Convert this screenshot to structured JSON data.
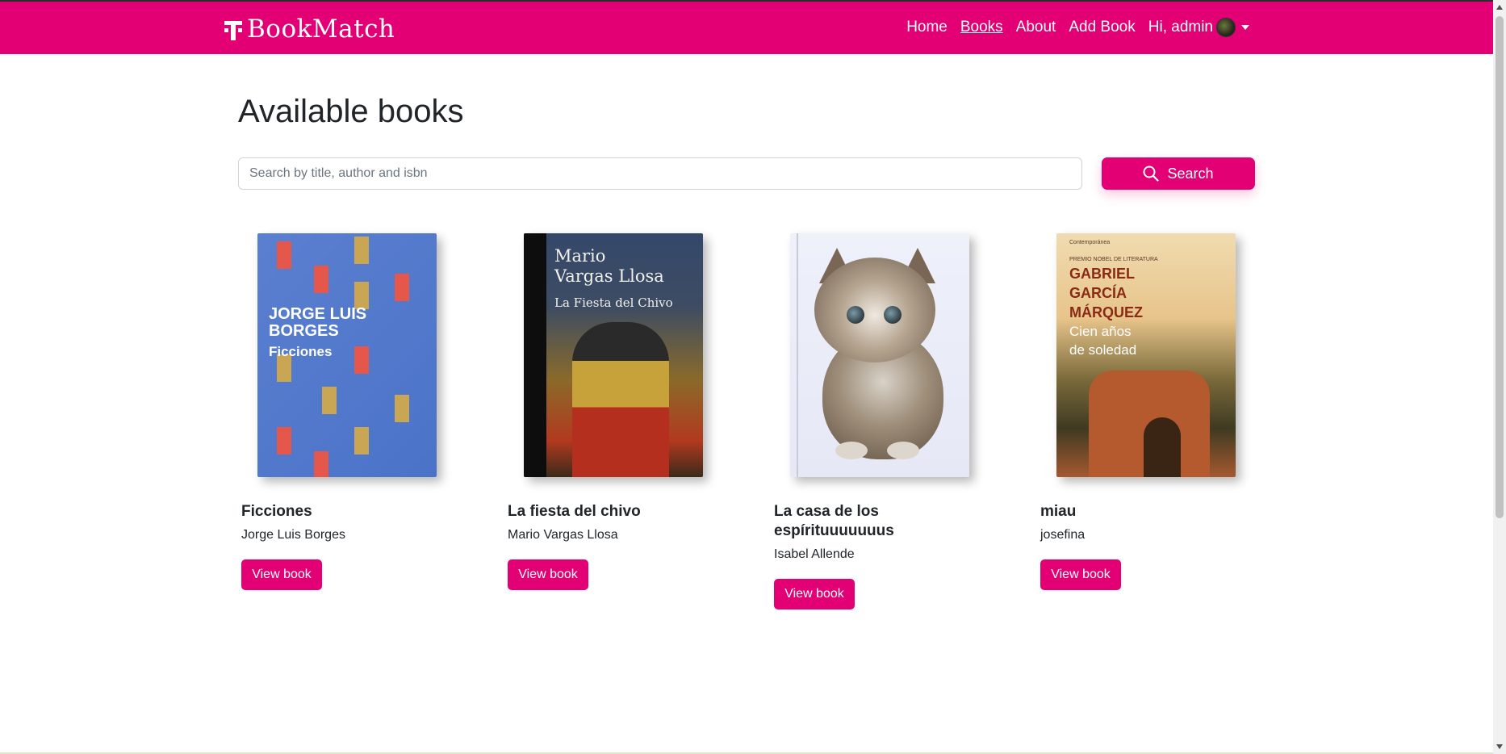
{
  "brand": {
    "name": "BookMatch",
    "icon": "telekom-t-logo"
  },
  "nav": {
    "items": [
      {
        "label": "Home",
        "active": false
      },
      {
        "label": "Books",
        "active": true
      },
      {
        "label": "About",
        "active": false
      },
      {
        "label": "Add Book",
        "active": false
      }
    ],
    "user": {
      "greeting": "Hi, admin"
    }
  },
  "page": {
    "title": "Available books"
  },
  "search": {
    "placeholder": "Search by title, author and isbn",
    "value": "",
    "button_label": "Search",
    "button_icon": "search-icon"
  },
  "books": [
    {
      "title": "Ficciones",
      "author": "Jorge Luis Borges",
      "button_label": "View book",
      "cover": {
        "line1": "JORGE LUIS",
        "line2": "BORGES",
        "line3": "Ficciones"
      }
    },
    {
      "title": "La fiesta del chivo",
      "author": "Mario Vargas Llosa",
      "button_label": "View book",
      "cover": {
        "line1": "Mario",
        "line2": "Vargas Llosa",
        "line3": "La Fiesta del Chivo"
      }
    },
    {
      "title": "La casa de los espírituuuuuuus",
      "author": "Isabel Allende",
      "button_label": "View book",
      "cover": {
        "image": "kitten-photo"
      }
    },
    {
      "title": "miau",
      "author": "josefina",
      "button_label": "View book",
      "cover": {
        "publisher": "Contemporánea",
        "prize": "PREMIO NOBEL DE LITERATURA",
        "line1": "GABRIEL",
        "line2": "GARCÍA",
        "line3": "MÁRQUEZ",
        "line4": "Cien años",
        "line5": "de soledad"
      }
    }
  ],
  "colors": {
    "brand": "#e20074",
    "text": "#212529",
    "background": "#ffffff"
  }
}
